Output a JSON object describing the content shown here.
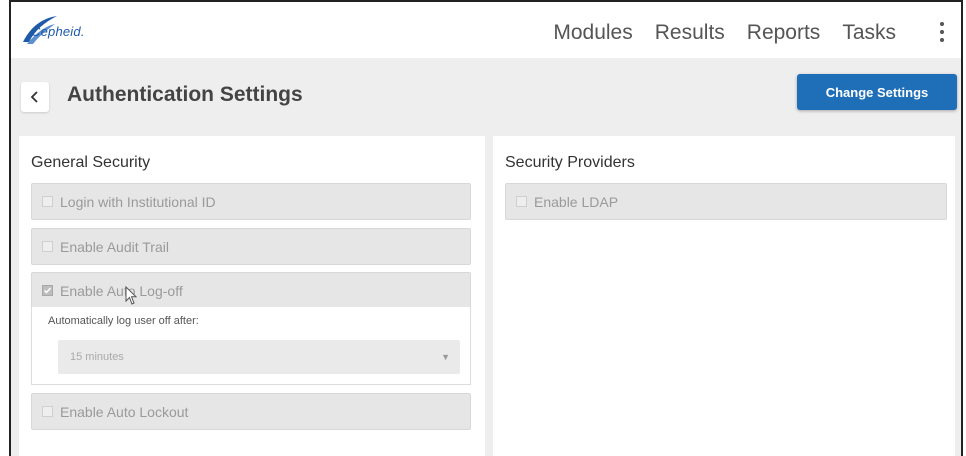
{
  "header": {
    "logo_text": "Cepheid.",
    "nav": [
      "Modules",
      "Results",
      "Reports",
      "Tasks"
    ]
  },
  "page": {
    "title": "Authentication Settings",
    "change_button": "Change Settings"
  },
  "general_security": {
    "title": "General Security",
    "options": [
      {
        "label": "Login with Institutional ID",
        "checked": false
      },
      {
        "label": "Enable Audit Trail",
        "checked": false
      },
      {
        "label": "Enable Auto Log-off",
        "checked": true
      },
      {
        "label": "Enable Auto Lockout",
        "checked": false
      }
    ],
    "auto_logoff": {
      "label": "Automatically log user off after:",
      "value": "15 minutes"
    }
  },
  "security_providers": {
    "title": "Security Providers",
    "options": [
      {
        "label": "Enable LDAP",
        "checked": false
      }
    ]
  },
  "colors": {
    "accent": "#1f6fb8",
    "band": "#eeeeee"
  }
}
